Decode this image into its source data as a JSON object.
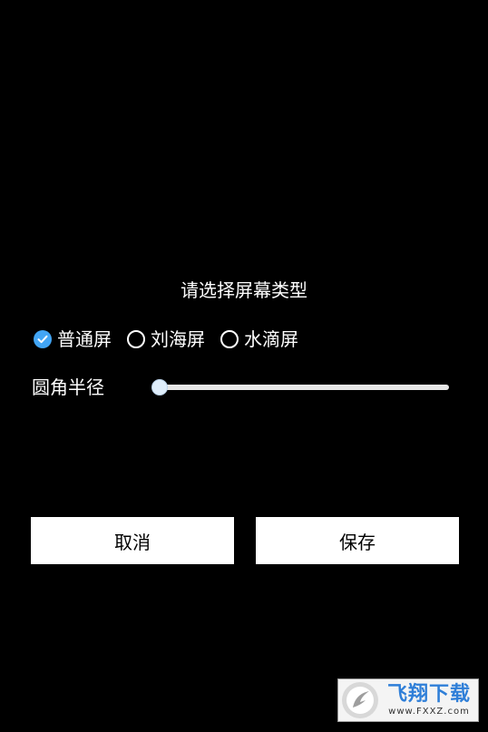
{
  "dialog": {
    "title": "请选择屏幕类型",
    "radio_options": [
      {
        "label": "普通屏",
        "checked": true
      },
      {
        "label": "刘海屏",
        "checked": false
      },
      {
        "label": "水滴屏",
        "checked": false
      }
    ],
    "slider": {
      "label": "圆角半径",
      "value_fraction": 0.0
    },
    "buttons": {
      "cancel_label": "取消",
      "save_label": "保存"
    }
  },
  "watermark": {
    "brand": "飞翔下载",
    "url": "www.FXXZ.com"
  },
  "colors": {
    "background": "#000000",
    "accent": "#42a5f5",
    "button_bg": "#ffffff"
  }
}
